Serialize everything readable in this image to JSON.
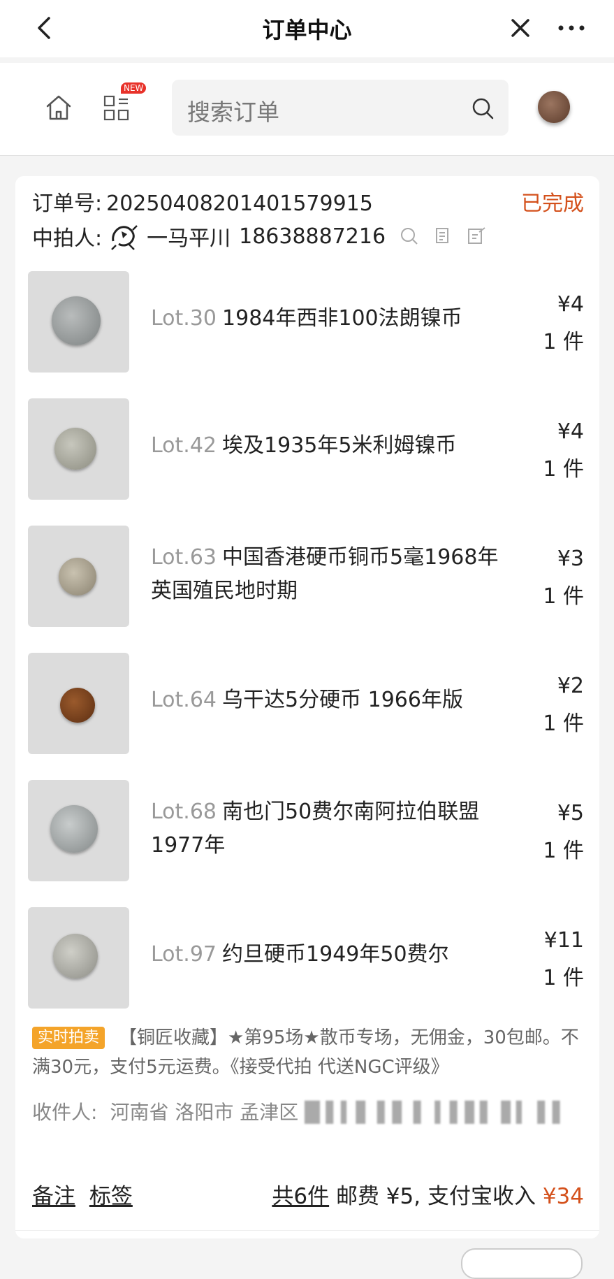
{
  "header": {
    "title": "订单中心",
    "search_placeholder": "搜索订单",
    "new_badge": "NEW"
  },
  "order": {
    "number_label": "订单号:",
    "number": "20250408201401579915",
    "status": "已完成",
    "buyer_label": "中拍人:",
    "buyer_name": "一马平川",
    "buyer_phone": "18638887216"
  },
  "items": [
    {
      "lot": "Lot.30",
      "name": "1984年西非100法朗镍币",
      "price": "¥4",
      "qty": "1 件"
    },
    {
      "lot": "Lot.42",
      "name": "埃及1935年5米利姆镍币",
      "price": "¥4",
      "qty": "1 件"
    },
    {
      "lot": "Lot.63",
      "name": "中国香港硬币铜币5毫1968年英国殖民地时期",
      "price": "¥3",
      "qty": "1 件"
    },
    {
      "lot": "Lot.64",
      "name": "乌干达5分硬币 1966年版",
      "price": "¥2",
      "qty": "1 件"
    },
    {
      "lot": "Lot.68",
      "name": "南也门50费尔南阿拉伯联盟1977年",
      "price": "¥5",
      "qty": "1 件"
    },
    {
      "lot": "Lot.97",
      "name": "约旦硬币1949年50费尔",
      "price": "¥11",
      "qty": "1 件"
    }
  ],
  "auction": {
    "tag": "实时拍卖",
    "description": "【铜匠收藏】★第95场★散币专场，无佣金，30包邮。不满30元，支付5元运费。《接受代拍 代送NGC评级》"
  },
  "receiver": {
    "label": "收件人:",
    "address": "河南省 洛阳市 孟津区"
  },
  "footer": {
    "note": "备注",
    "tag": "标签",
    "count": "共6件",
    "shipping": "邮费 ¥5, 支付宝收入",
    "total": "¥34"
  },
  "colors": {
    "accent": "#d4511c",
    "tag_orange": "#f4a42a",
    "new_badge": "#e8322a"
  }
}
